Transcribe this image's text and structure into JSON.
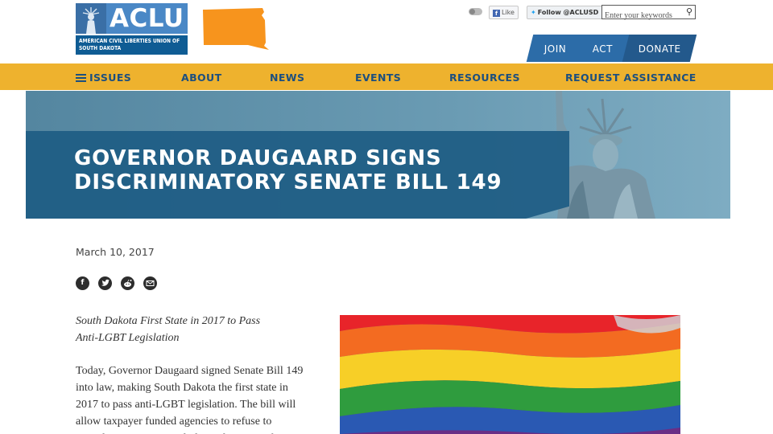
{
  "header": {
    "logo": {
      "wordmark": "ACLU",
      "subtitle": "AMERICAN CIVIL LIBERTIES UNION of SOUTH DAKOTA"
    },
    "social": {
      "like_label": "Like",
      "follow_label": "Follow @ACLUSD"
    },
    "search": {
      "placeholder": "Enter your keywords"
    },
    "cta": {
      "join": "JOIN",
      "act": "ACT",
      "donate": "DONATE"
    }
  },
  "nav": {
    "items": [
      "ISSUES",
      "ABOUT",
      "NEWS",
      "EVENTS",
      "RESOURCES",
      "REQUEST ASSISTANCE"
    ]
  },
  "hero": {
    "title": "GOVERNOR DAUGAARD SIGNS\nDISCRIMINATORY SENATE BILL 149"
  },
  "article": {
    "date": "March 10, 2017",
    "share_icons": [
      "facebook-icon",
      "twitter-icon",
      "reddit-icon",
      "email-icon"
    ],
    "subhead": "South Dakota First State in 2017 to Pass\nAnti-LGBT Legislation",
    "body": "Today, Governor Daugaard signed Senate Bill 149\ninto law, making South Dakota the first state in\n2017 to pass anti-LGBT legislation. The bill will\nallow taxpayer funded agencies to refuse to\nprovide any service, including adoption or foster"
  },
  "colors": {
    "nav_bg": "#eeb22e",
    "nav_text": "#1c4f7f",
    "brand_blue": "#2c6ca8",
    "hero_band": "#205e85",
    "state_orange": "#f7941d"
  }
}
